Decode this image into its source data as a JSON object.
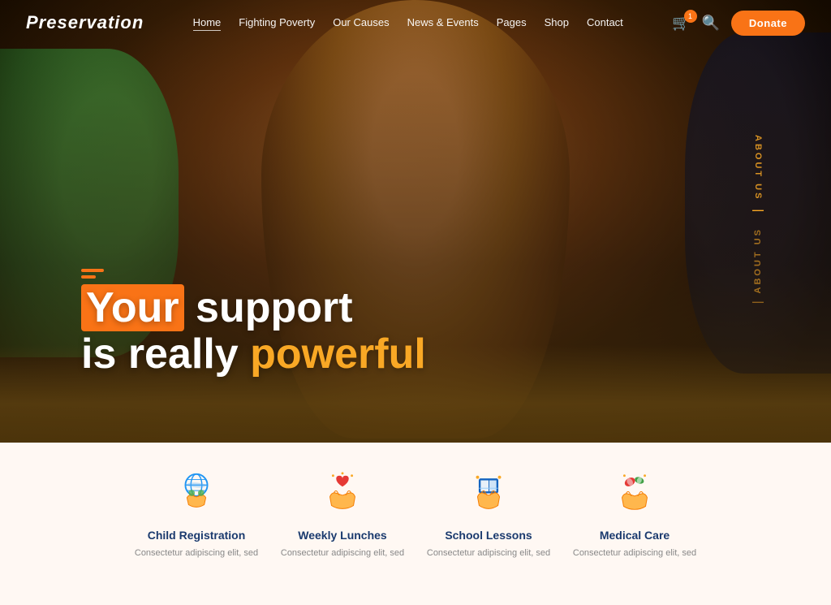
{
  "brand": {
    "logo": "Preservation",
    "accent_color": "#f97316"
  },
  "nav": {
    "links": [
      {
        "id": "home",
        "label": "Home",
        "active": true
      },
      {
        "id": "fighting-poverty",
        "label": "Fighting Poverty",
        "active": false
      },
      {
        "id": "our-causes",
        "label": "Our Causes",
        "active": false
      },
      {
        "id": "news-events",
        "label": "News & Events",
        "active": false
      },
      {
        "id": "pages",
        "label": "Pages",
        "active": false
      },
      {
        "id": "shop",
        "label": "Shop",
        "active": false
      },
      {
        "id": "contact",
        "label": "Contact",
        "active": false
      }
    ],
    "cart_count": "1",
    "donate_label": "Donate"
  },
  "hero": {
    "title_part1": "Your",
    "title_part1_highlight": "Your",
    "title_part2": " support",
    "title_line2_part1": "is really ",
    "title_line2_highlight": "powerful",
    "deco_label": "About Us"
  },
  "services": [
    {
      "id": "child-registration",
      "title": "Child Registration",
      "description": "Consectetur adipiscing elit, sed",
      "icon_label": "globe-hands-icon"
    },
    {
      "id": "weekly-lunches",
      "title": "Weekly Lunches",
      "description": "Consectetur adipiscing elit, sed",
      "icon_label": "hearts-hands-icon"
    },
    {
      "id": "school-lessons",
      "title": "School Lessons",
      "description": "Consectetur adipiscing elit, sed",
      "icon_label": "book-hand-icon"
    },
    {
      "id": "medical-care",
      "title": "Medical Care",
      "description": "Consectetur adipiscing elit, sed",
      "icon_label": "medical-hands-icon"
    }
  ]
}
